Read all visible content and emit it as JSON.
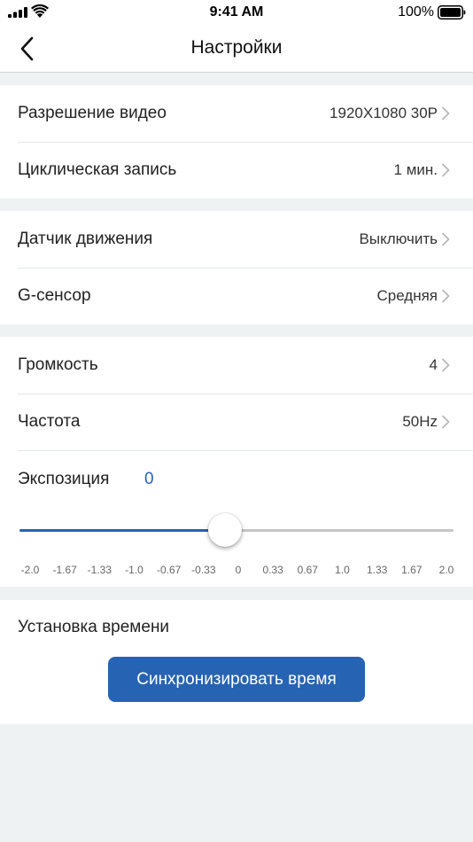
{
  "status_bar": {
    "time": "9:41 AM",
    "battery_percent": "100%",
    "icons": [
      "signal-icon",
      "wifi-icon",
      "battery-icon"
    ]
  },
  "nav": {
    "title": "Настройки",
    "back_icon": "chevron-left-icon"
  },
  "sections": {
    "video": {
      "resolution": {
        "label": "Разрешение видео",
        "value": "1920X1080 30P"
      },
      "loop": {
        "label": "Циклическая запись",
        "value": "1 мин."
      }
    },
    "sensors": {
      "motion": {
        "label": "Датчик движения",
        "value": "Выключить"
      },
      "gsensor": {
        "label": "G-сенсор",
        "value": "Средняя"
      }
    },
    "audio": {
      "volume": {
        "label": "Громкость",
        "value": "4"
      },
      "frequency": {
        "label": "Частота",
        "value": "50Hz"
      }
    },
    "exposure": {
      "label": "Экспозиция",
      "value": "0",
      "min": -2.0,
      "max": 2.0,
      "ticks": [
        "-2.0",
        "-1.67",
        "-1.33",
        "-1.0",
        "-0.67",
        "-0.33",
        "0",
        "0.33",
        "0.67",
        "1.0",
        "1.33",
        "1.67",
        "2.0"
      ]
    },
    "time": {
      "label": "Установка времени",
      "sync_button": "Синхронизировать время"
    }
  },
  "colors": {
    "accent": "#2763b3",
    "background": "#eef2f2",
    "track": "#c5c5c5"
  }
}
